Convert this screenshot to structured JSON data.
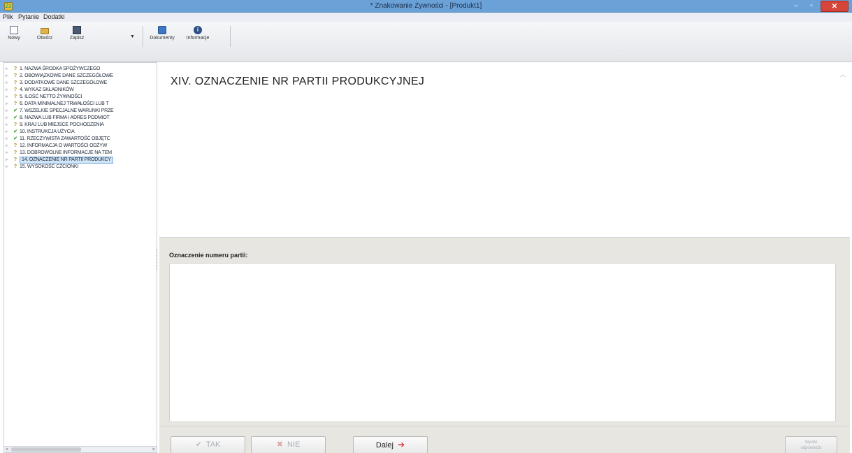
{
  "window": {
    "title": "* Znakowanie Żywności - [Produkt1]",
    "app_icon_glyph": "Zz",
    "minimize_glyph": "–",
    "maximize_glyph": "▫",
    "close_glyph": "✕"
  },
  "menu": {
    "items": [
      "Plik",
      "Pytanie",
      "Dodatki"
    ]
  },
  "toolbar": {
    "buttons": [
      {
        "label": "Nowy",
        "icon": "new-document-icon"
      },
      {
        "label": "Otwórz",
        "icon": "folder-icon"
      },
      {
        "label": "Zapisz",
        "icon": "save-icon"
      },
      {
        "label": "Dokumenty",
        "icon": "documents-icon"
      },
      {
        "label": "Informacje",
        "icon": "info-icon"
      }
    ],
    "save_dropdown_glyph": "▼"
  },
  "tree": {
    "items": [
      {
        "status": "?",
        "label": "1. NAZWA ŚRODKA SPOŻYWCZEGO"
      },
      {
        "status": "?",
        "label": "2. OBOWIĄZKOWE DANE SZCZEGÓŁOWE"
      },
      {
        "status": "?",
        "label": "3. DODATKOWE DANE SZCZEGÓŁOWE"
      },
      {
        "status": "?",
        "label": "4. WYKAZ SKŁADNIKÓW"
      },
      {
        "status": "?",
        "label": "5. ILOŚĆ NETTO ŻYWNOŚCI"
      },
      {
        "status": "?",
        "label": "6. DATA MINIMALNEJ TRWAŁOŚCI LUB T"
      },
      {
        "status": "✔",
        "label": "7. WSZELKIE SPECJALNE WARUNKI PRZE"
      },
      {
        "status": "✔",
        "label": "8. NAZWA LUB FIRMA I ADRES PODMIOT"
      },
      {
        "status": "?",
        "label": "9. KRAJ LUB MIEJSCE POCHODZENIA"
      },
      {
        "status": "✔",
        "label": "10. INSTRUKCJA UŻYCIA"
      },
      {
        "status": "✔",
        "label": "11. RZECZYWISTA ZAWARTOŚĆ OBJĘTC"
      },
      {
        "status": "?",
        "label": "12. INFORMACJA O WARTOŚCI ODŻYW"
      },
      {
        "status": "?",
        "label": "13. DOBROWOLNE INFORMACJE NA TEM"
      },
      {
        "status": "?",
        "label": "14. OZNACZENIE NR PARTII PRODUKCY"
      },
      {
        "status": "?",
        "label": "15. WYSOKOŚĆ CZCIONKI"
      }
    ],
    "selected_index": 13,
    "expander_glyph": "▹"
  },
  "question": {
    "title": "XIV. OZNACZENIE NR PARTII PRODUKCYJNEJ",
    "scroll_up_glyph": "︿"
  },
  "input": {
    "label": "Oznaczenie numeru partii:",
    "value": ""
  },
  "buttons": {
    "yes_label": "TAK",
    "no_label": "NIE",
    "next_label": "Dalej",
    "yes_icon": "✔",
    "no_icon": "✖",
    "next_icon": "➔",
    "right_label_1": "Wyniki",
    "right_label_2": "odpowiedzi"
  },
  "colors": {
    "titlebar": "#6aa2d8",
    "close_button": "#d6453a",
    "selection": "#cfe4f7",
    "status_ok": "#3a9d2a",
    "status_question": "#b0871d"
  }
}
